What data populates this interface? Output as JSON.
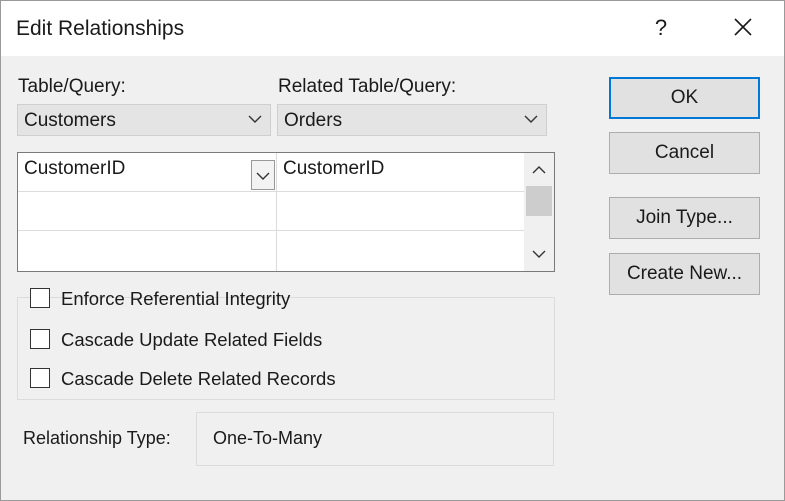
{
  "window": {
    "title": "Edit Relationships",
    "help_label": "?"
  },
  "left": {
    "label": "Table/Query:",
    "value": "Customers"
  },
  "right": {
    "label": "Related Table/Query:",
    "value": "Orders"
  },
  "fields": {
    "rows": [
      {
        "left": "CustomerID",
        "right": "CustomerID"
      },
      {
        "left": "",
        "right": ""
      },
      {
        "left": "",
        "right": ""
      }
    ]
  },
  "options": {
    "enforce": {
      "label": "Enforce Referential Integrity",
      "checked": false
    },
    "cascade_update": {
      "label": "Cascade Update Related Fields",
      "checked": false
    },
    "cascade_delete": {
      "label": "Cascade Delete Related Records",
      "checked": false
    }
  },
  "relationship": {
    "label": "Relationship Type:",
    "value": "One-To-Many"
  },
  "buttons": {
    "ok": "OK",
    "cancel": "Cancel",
    "join_type": "Join Type...",
    "create_new": "Create New..."
  },
  "icons": {
    "close": "close-icon",
    "dropdown": "chevron-down-icon",
    "scroll_up": "chevron-up-icon",
    "scroll_down": "chevron-down-icon"
  },
  "colors": {
    "accent": "#0078d7",
    "dialog_bg": "#f0f0f0",
    "title_bg": "#ffffff"
  }
}
